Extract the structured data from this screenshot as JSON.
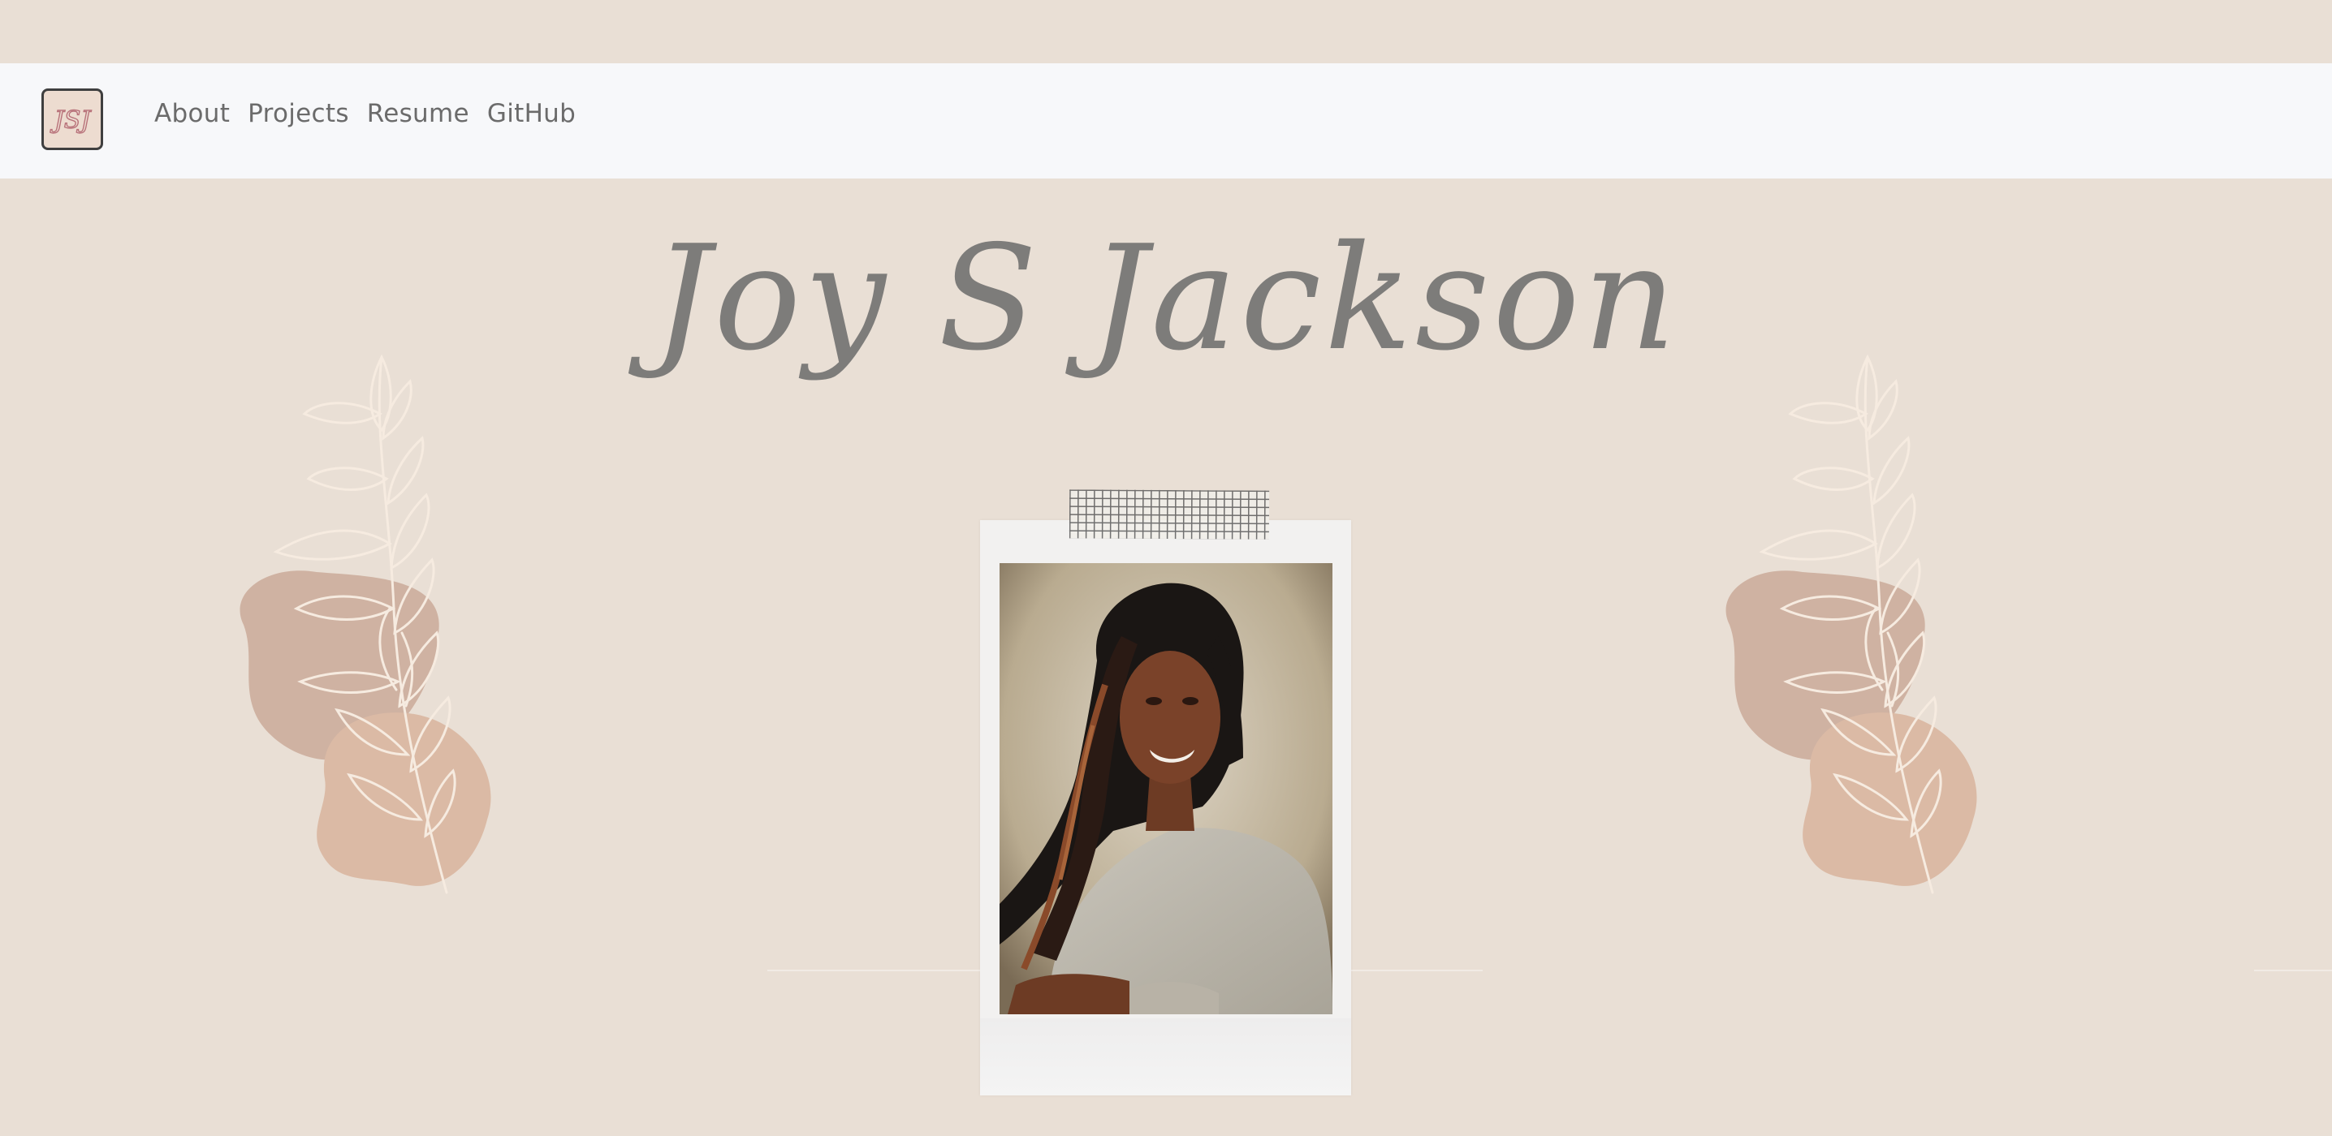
{
  "logo": {
    "text": "JSJ",
    "icon": "jsj-monogram-logo"
  },
  "nav": {
    "items": [
      {
        "label": "About"
      },
      {
        "label": "Projects"
      },
      {
        "label": "Resume"
      },
      {
        "label": "GitHub"
      }
    ]
  },
  "hero": {
    "name": "Joy S Jackson"
  },
  "colors": {
    "background": "#e9dfd5",
    "navbar": "#f7f8fa",
    "nav_text": "#6b6b6b",
    "title_text": "#7d7c7a",
    "blob_dark": "#cfb2a2",
    "blob_light": "#dbbaa5",
    "leaf": "#f6ebe0"
  },
  "icons": {
    "left_decor": "botanical-leaf-branch-icon",
    "right_decor": "botanical-leaf-branch-icon",
    "tape": "washi-tape-grid"
  }
}
